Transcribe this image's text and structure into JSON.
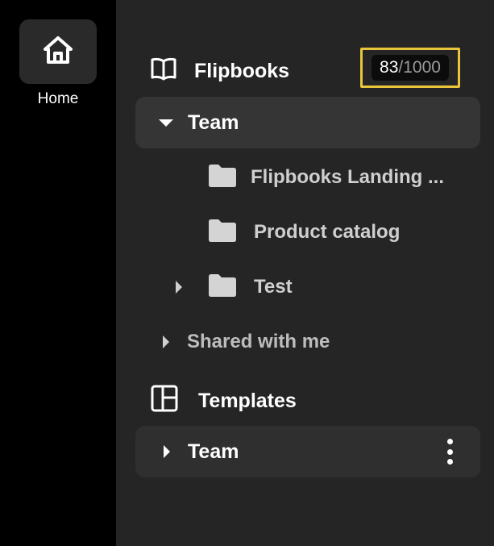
{
  "rail": {
    "home_label": "Home"
  },
  "flipbooks": {
    "title": "Flipbooks",
    "counter": {
      "used": "83",
      "separator": "/",
      "max": "1000"
    },
    "team": {
      "label": "Team",
      "items": [
        {
          "label": "Flipbooks Landing ..."
        },
        {
          "label": "Product catalog"
        },
        {
          "label": "Test"
        }
      ]
    },
    "shared_label": "Shared with me"
  },
  "templates": {
    "title": "Templates",
    "team_label": "Team"
  },
  "colors": {
    "rail_bg": "#000000",
    "panel_bg": "#252525",
    "selected_row_bg": "#353535",
    "counter_highlight": "#e9c53c",
    "folder_icon": "#d4d4d4"
  }
}
